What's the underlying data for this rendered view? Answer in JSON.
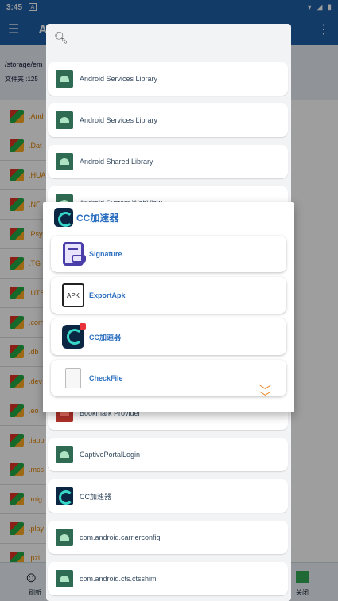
{
  "status_bar": {
    "time": "3:45",
    "notification_badge": "A",
    "icons": [
      "wifi-icon",
      "signal-icon",
      "battery-icon"
    ]
  },
  "background": {
    "app_title": "A",
    "path": "/storage/em",
    "folder_count": "文件夹 :125",
    "files": [
      ".And",
      ".Dat",
      ".HUA",
      ".NF",
      ".Psy",
      ".TG",
      ".UTS",
      ".com",
      ".db",
      ".dev",
      ".eo",
      ".iapp",
      ".mcs",
      ".mig",
      ".play",
      ".pzi"
    ],
    "bottom_left_label": "刷新",
    "bottom_right_label": "关闭"
  },
  "picker": {
    "search_icon": "search-icon",
    "items": [
      {
        "name": "Android Services Library",
        "icon": "android"
      },
      {
        "name": "Android Services Library",
        "icon": "android"
      },
      {
        "name": "Android Shared Library",
        "icon": "android"
      },
      {
        "name": "Android System WebView",
        "icon": "android"
      },
      {
        "name": "Bookmark Provider",
        "icon": "bookmark"
      },
      {
        "name": "CaptivePortalLogin",
        "icon": "android"
      },
      {
        "name": "CC加速器",
        "icon": "cc"
      },
      {
        "name": "com.android.carrierconfig",
        "icon": "android"
      },
      {
        "name": "com.android.cts.ctsshim",
        "icon": "android"
      }
    ]
  },
  "dialog": {
    "title": "CC加速器",
    "options": [
      {
        "label": "Signature",
        "icon": "signature-icon"
      },
      {
        "label": "ExportApk",
        "icon": "apk-file-icon",
        "icon_text": "APK"
      },
      {
        "label": "CC加速器",
        "icon": "cc-app-icon"
      },
      {
        "label": "CheckFile",
        "icon": "file-icon"
      }
    ],
    "expand_icon": "double-chevron-down-icon"
  }
}
